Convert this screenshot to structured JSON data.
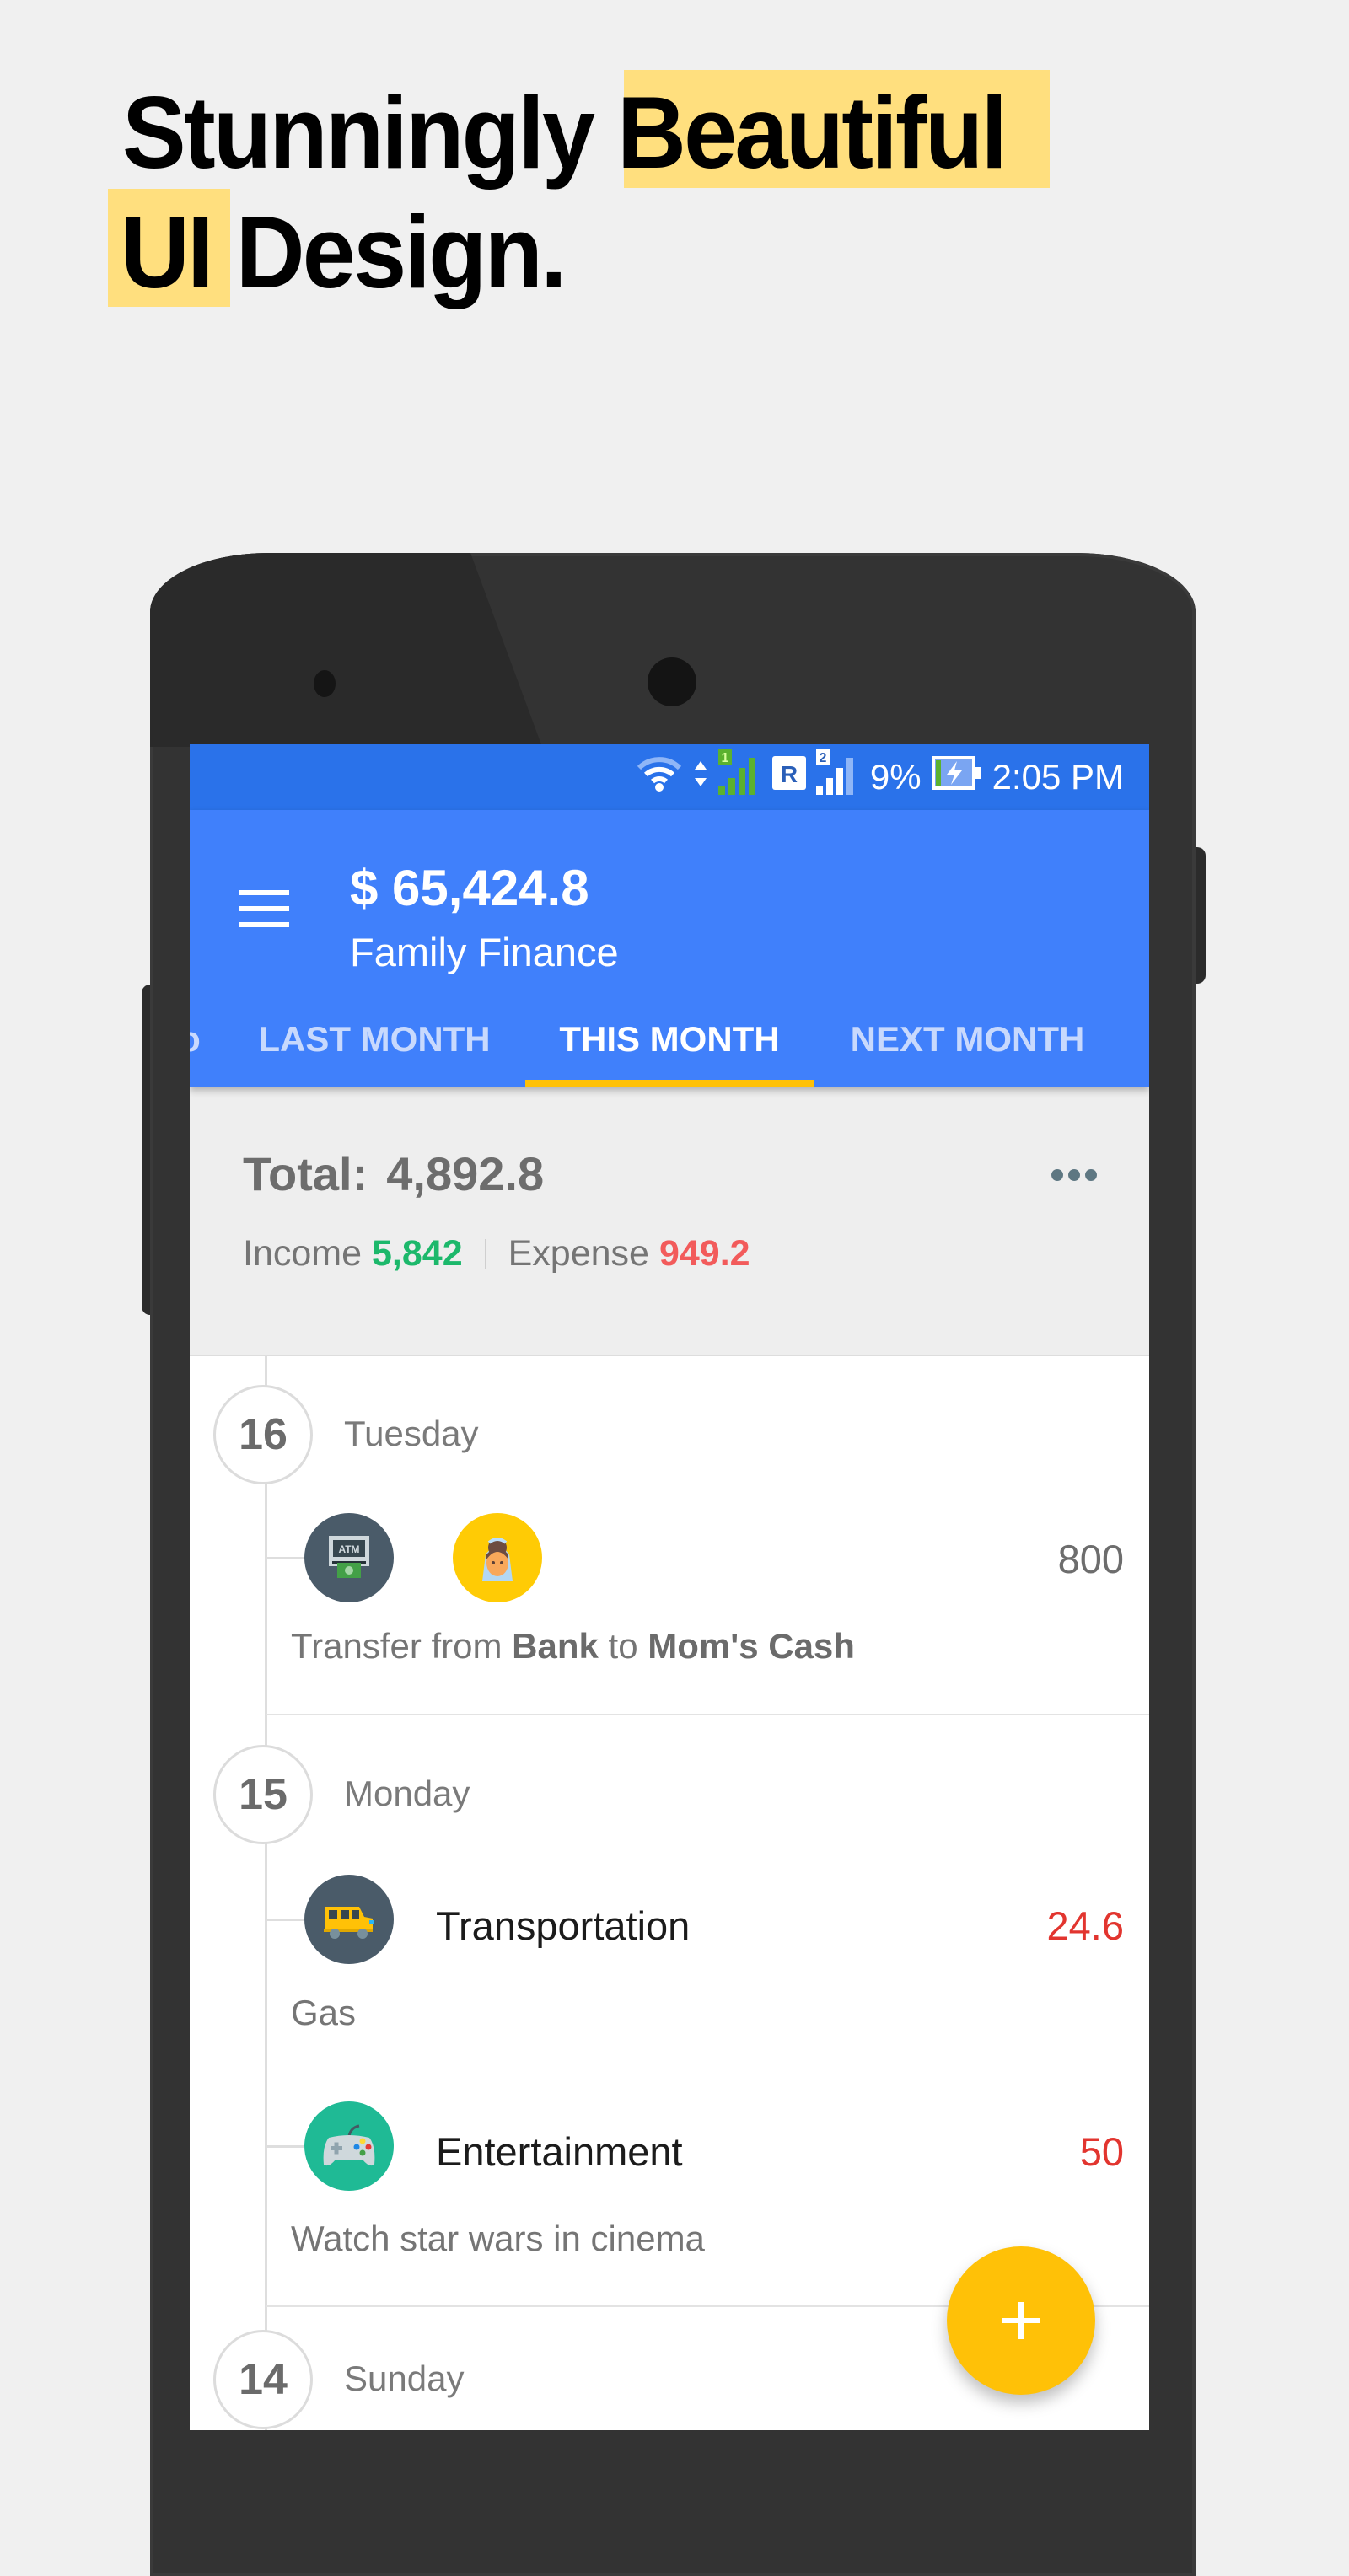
{
  "headline": {
    "line1_plain": "Stunningly ",
    "line1_highlight": "Beautiful",
    "line2_highlight": "UI",
    "line2_plain": " Design.",
    "highlight_color": "#ffdf7e"
  },
  "status_bar": {
    "icons": [
      "wifi-icon",
      "data-arrows-icon",
      "sim1-signal-icon",
      "roaming-icon",
      "sim2-signal-icon",
      "battery-charging-icon"
    ],
    "sim1_label": "1",
    "roaming_label": "R",
    "sim2_label": "2",
    "battery_percent": "9%",
    "time": "2:05 PM"
  },
  "app_bar": {
    "balance": "$ 65,424.8",
    "book_name": "Family Finance",
    "menu_icon": "hamburger-menu-icon",
    "color": "#4080fb"
  },
  "tabs": {
    "clipped_prev": "o",
    "items": [
      {
        "label": "LAST MONTH",
        "active": false
      },
      {
        "label": "THIS MONTH",
        "active": true
      },
      {
        "label": "NEXT MONTH",
        "active": false
      }
    ],
    "indicator_color": "#ffc107"
  },
  "summary": {
    "total_label": "Total:",
    "total_value": "4,892.8",
    "income_label": "Income",
    "income_value": "5,842",
    "expense_label": "Expense",
    "expense_value": "949.2",
    "more_icon": "more-horizontal-icon",
    "income_color": "#1cb86b",
    "expense_color": "#f25b5b"
  },
  "days": [
    {
      "day": "16",
      "weekday": "Tuesday",
      "records": [
        {
          "type": "transfer",
          "from_icon": "atm-icon",
          "to_icon": "bride-avatar-icon",
          "amount": "800",
          "note_prefix": "Transfer from",
          "from": "Bank",
          "note_mid": "to",
          "to": "Mom's Cash"
        }
      ]
    },
    {
      "day": "15",
      "weekday": "Monday",
      "records": [
        {
          "type": "expense",
          "icon": "car-icon",
          "category": "Transportation",
          "amount": "24.6",
          "note": "Gas"
        },
        {
          "type": "expense",
          "icon": "gamepad-icon",
          "category": "Entertainment",
          "amount": "50",
          "note": "Watch star wars in cinema"
        }
      ]
    },
    {
      "day": "14",
      "weekday": "Sunday",
      "records": []
    }
  ],
  "fab": {
    "icon": "plus-icon",
    "color": "#ffc107"
  }
}
